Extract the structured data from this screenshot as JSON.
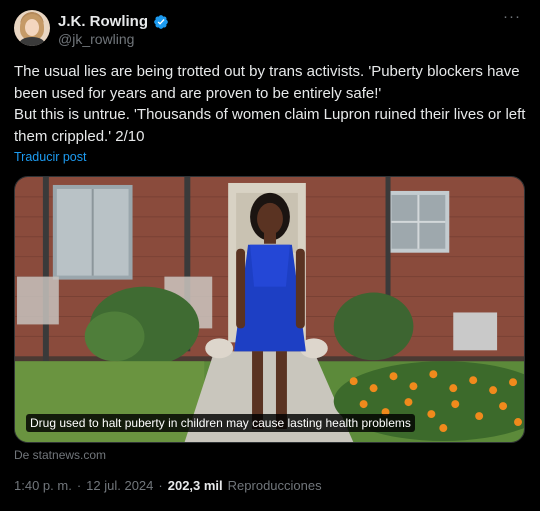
{
  "author": {
    "name": "J.K. Rowling",
    "handle": "@jk_rowling",
    "avatar_icon": "profile-avatar",
    "verified_icon": "verified-badge-icon",
    "verified_color": "#1d9bf0"
  },
  "more_label": "···",
  "post": {
    "text": "The usual lies are being trotted out by trans activists. 'Puberty blockers have been used for years and are proven to be entirely safe!'\nBut this is untrue. 'Thousands of women claim Lupron ruined their lives or left them crippled.' 2/10",
    "translate_label": "Traducir post"
  },
  "card": {
    "caption": "Drug used to halt puberty in children may cause lasting health problems",
    "source": "De statnews.com"
  },
  "footer": {
    "time": "1:40 p. m.",
    "separator": "·",
    "date": "12 jul. 2024",
    "views_count": "202,3 mil",
    "views_label": "Reproducciones"
  },
  "colors": {
    "background": "#000000",
    "text": "#e7e9ea",
    "secondary": "#71767b",
    "link": "#1d9bf0"
  }
}
